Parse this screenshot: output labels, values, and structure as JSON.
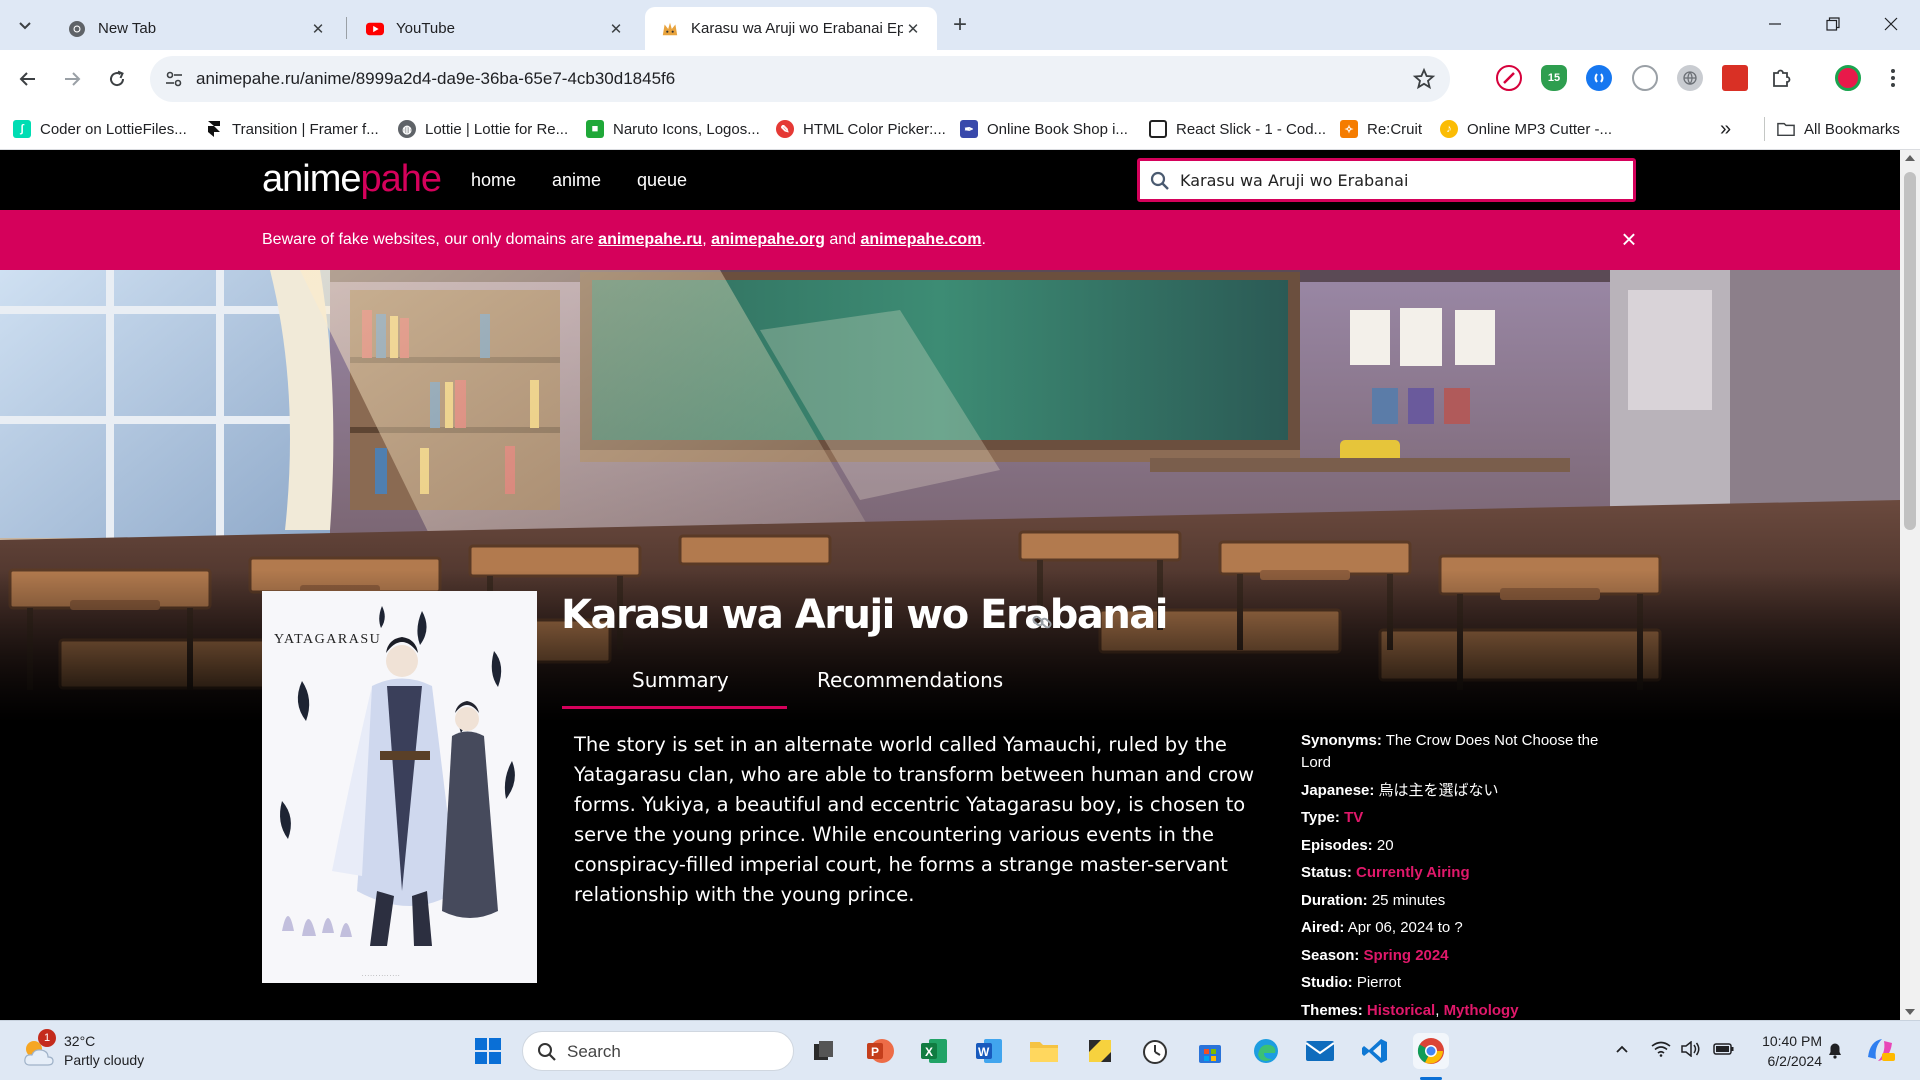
{
  "browser": {
    "tabs": [
      {
        "title": "New Tab",
        "active": false
      },
      {
        "title": "YouTube",
        "active": false
      },
      {
        "title": "Karasu wa Aruji wo Erabanai Ep",
        "active": true
      }
    ],
    "new_tab_label": "+",
    "url": "animepahe.ru/anime/8999a2d4-da9e-36ba-65e7-4cb30d1845f6",
    "extension_badge": "15",
    "bookmarks": [
      {
        "label": "Coder on LottieFiles...",
        "icon": "lottiefiles-icon",
        "color": "#00ddb3"
      },
      {
        "label": "Transition | Framer f...",
        "icon": "framer-icon",
        "color": "#111111"
      },
      {
        "label": "Lottie | Lottie for Re...",
        "icon": "globe-icon",
        "color": "#5f6368"
      },
      {
        "label": "Naruto Icons, Logos...",
        "icon": "iconscout-icon",
        "color": "#1fa838"
      },
      {
        "label": "HTML Color Picker:...",
        "icon": "color-picker-icon",
        "color": "#e53935"
      },
      {
        "label": "Online Book Shop i...",
        "icon": "book-shop-icon",
        "color": "#3949ab"
      },
      {
        "label": "React Slick - 1 - Cod...",
        "icon": "codesandbox-icon",
        "color": "#222222"
      },
      {
        "label": "Re:Cruit",
        "icon": "recruit-icon",
        "color": "#f57c00"
      },
      {
        "label": "Online MP3 Cutter -...",
        "icon": "mp3-cutter-icon",
        "color": "#fbbc04"
      }
    ],
    "more_bookmarks": "»",
    "all_bookmarks": "All Bookmarks"
  },
  "site": {
    "logo_first": "anime",
    "logo_second": "pahe",
    "nav": [
      "home",
      "anime",
      "queue"
    ],
    "search_value": "Karasu wa Aruji wo Erabanai",
    "banner": {
      "prefix": "Beware of fake websites, our only domains are ",
      "domain1": "animepahe.ru",
      "sep1": ", ",
      "domain2": "animepahe.org",
      "sep2": " and ",
      "domain3": "animepahe.com",
      "suffix": ".",
      "close": "×"
    },
    "accent_color": "#d5015b"
  },
  "anime": {
    "title": "Karasu wa Aruji wo Erabanai",
    "poster_text": "YATAGARASU",
    "tabs": [
      "Summary",
      "Recommendations"
    ],
    "synopsis": "The story is set in an alternate world called Yamauchi, ruled by the Yatagarasu clan, who are able to transform between human and crow forms. Yukiya, a beautiful and eccentric Yatagarasu boy, is chosen to serve the young prince. While encountering various events in the conspiracy-filled imperial court, he forms a strange master-servant relationship with the young prince.",
    "info": {
      "synonyms_label": "Synonyms:",
      "synonyms": "The Crow Does Not Choose the Lord",
      "japanese_label": "Japanese:",
      "japanese": "烏は主を選ばない",
      "type_label": "Type:",
      "type": "TV",
      "episodes_label": "Episodes:",
      "episodes": "20",
      "status_label": "Status:",
      "status": "Currently Airing",
      "duration_label": "Duration:",
      "duration": "25 minutes",
      "aired_label": "Aired:",
      "aired": "Apr 06, 2024 to ?",
      "season_label": "Season:",
      "season": "Spring 2024",
      "studio_label": "Studio:",
      "studio": "Pierrot",
      "themes_label": "Themes:",
      "theme1": "Historical",
      "theme_sep": ", ",
      "theme2": "Mythology"
    }
  },
  "taskbar": {
    "weather_badge": "1",
    "temperature": "32°C",
    "condition": "Partly cloudy",
    "search_label": "Search",
    "time": "10:40 PM",
    "date": "6/2/2024"
  }
}
